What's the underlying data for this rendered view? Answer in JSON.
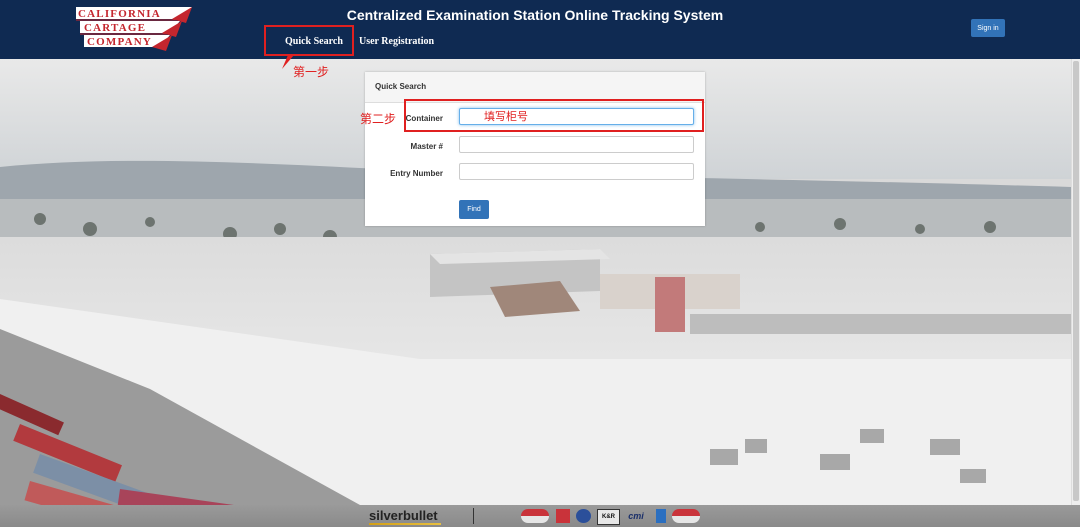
{
  "header": {
    "logo": {
      "line1": "CALIFORNIA",
      "line2": "CARTAGE",
      "line3": "COMPANY"
    },
    "title": "Centralized Examination Station Online Tracking System",
    "nav": {
      "quick_search": "Quick Search",
      "user_registration": "User Registration"
    },
    "sign_in": "Sign in"
  },
  "annotations": {
    "step1": "第一步",
    "step2": "第二步"
  },
  "search_panel": {
    "title": "Quick Search",
    "fields": {
      "container": {
        "label": "Container",
        "placeholder": "填写柜号"
      },
      "master": {
        "label": "Master #"
      },
      "entry": {
        "label": "Entry Number"
      }
    },
    "find_button": "Find"
  },
  "footer": {
    "brand": "silverbullet",
    "partners": [
      "",
      "",
      "",
      "K&R",
      "cmi",
      "",
      ""
    ]
  },
  "colors": {
    "header_bg": "#0f2a52",
    "button_blue": "#3273b8",
    "annotation_red": "#e02020"
  }
}
